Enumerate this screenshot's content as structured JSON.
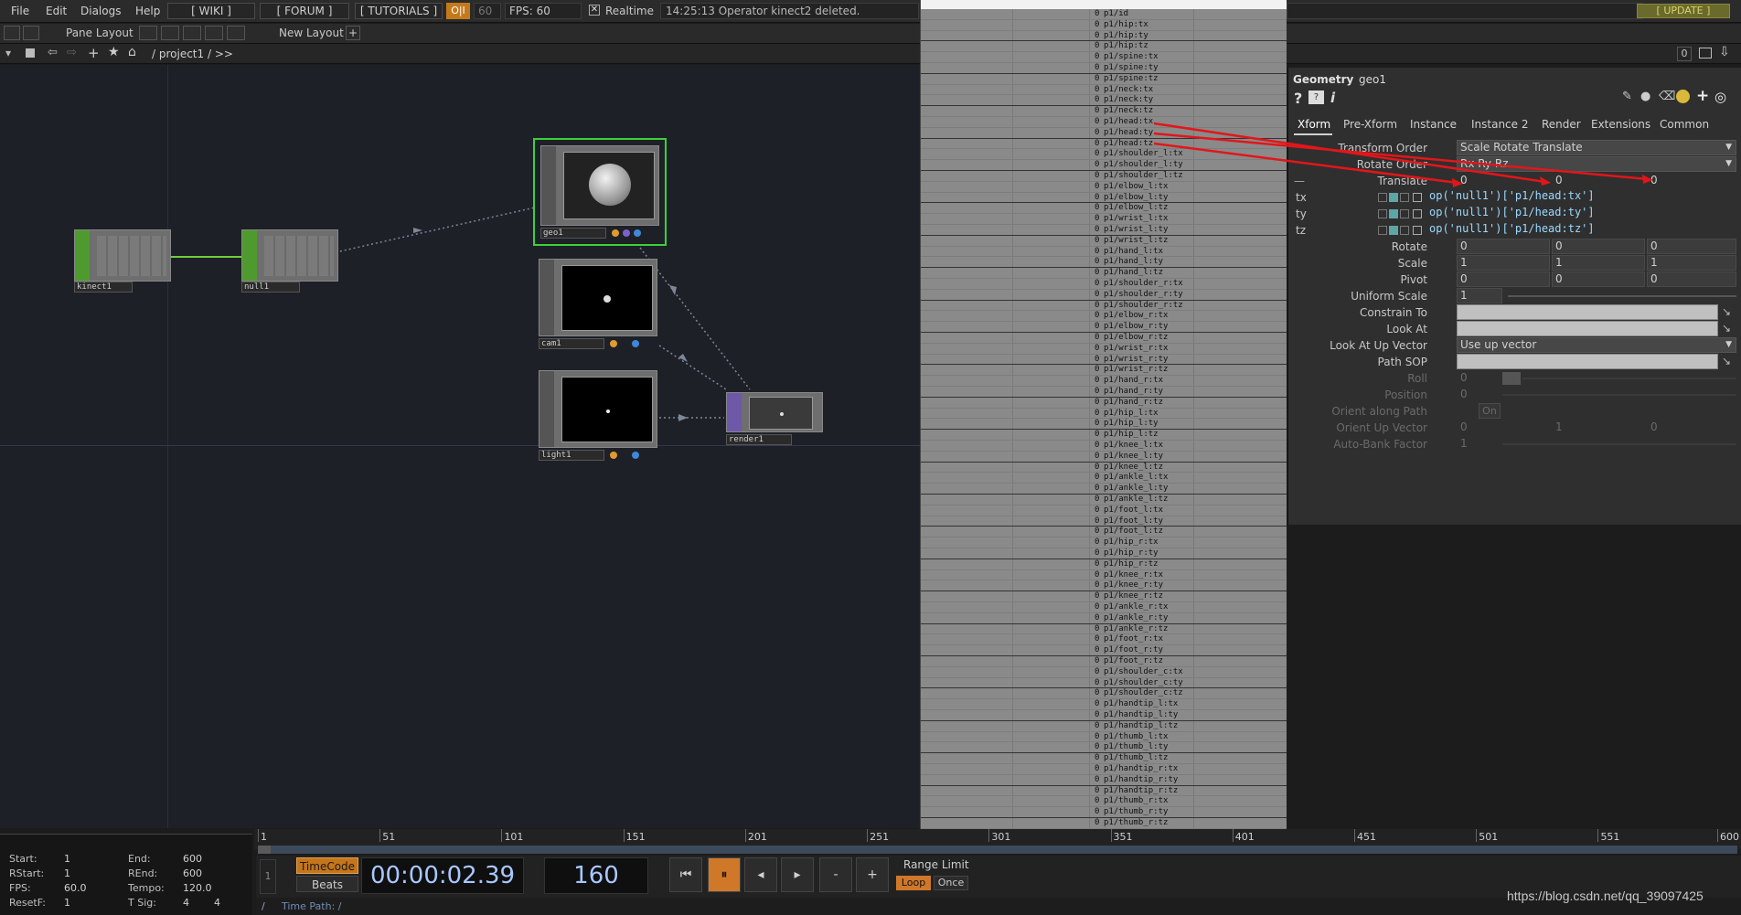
{
  "menubar": {
    "items": [
      "File",
      "Edit",
      "Dialogs",
      "Help"
    ],
    "wiki": "[ WIKI ]",
    "forum": "[ FORUM ]",
    "tutorials": "[ TUTORIALS ]",
    "oi": "O|I",
    "fps_box": "60",
    "fps_label": "FPS:  60",
    "realtime_label": "Realtime",
    "message": "14:25:13 Operator kinect2 deleted.",
    "update": "[ UPDATE ]"
  },
  "pane_row": {
    "pane_layout": "Pane Layout",
    "new_layout": "New Layout"
  },
  "path_row": {
    "path": "/ project1 / >>",
    "right_value": "0"
  },
  "nodes": {
    "kinect1": "kinect1",
    "null1": "null1",
    "geo1": "geo1",
    "cam1": "cam1",
    "light1": "light1",
    "render1": "render1"
  },
  "table": {
    "value": "0",
    "rows": [
      "p1/id",
      "p1/hip:tx",
      "p1/hip:ty",
      "p1/hip:tz",
      "p1/spine:tx",
      "p1/spine:ty",
      "p1/spine:tz",
      "p1/neck:tx",
      "p1/neck:ty",
      "p1/neck:tz",
      "p1/head:tx",
      "p1/head:ty",
      "p1/head:tz",
      "p1/shoulder_l:tx",
      "p1/shoulder_l:ty",
      "p1/shoulder_l:tz",
      "p1/elbow_l:tx",
      "p1/elbow_l:ty",
      "p1/elbow_l:tz",
      "p1/wrist_l:tx",
      "p1/wrist_l:ty",
      "p1/wrist_l:tz",
      "p1/hand_l:tx",
      "p1/hand_l:ty",
      "p1/hand_l:tz",
      "p1/shoulder_r:tx",
      "p1/shoulder_r:ty",
      "p1/shoulder_r:tz",
      "p1/elbow_r:tx",
      "p1/elbow_r:ty",
      "p1/elbow_r:tz",
      "p1/wrist_r:tx",
      "p1/wrist_r:ty",
      "p1/wrist_r:tz",
      "p1/hand_r:tx",
      "p1/hand_r:ty",
      "p1/hand_r:tz",
      "p1/hip_l:tx",
      "p1/hip_l:ty",
      "p1/hip_l:tz",
      "p1/knee_l:tx",
      "p1/knee_l:ty",
      "p1/knee_l:tz",
      "p1/ankle_l:tx",
      "p1/ankle_l:ty",
      "p1/ankle_l:tz",
      "p1/foot_l:tx",
      "p1/foot_l:ty",
      "p1/foot_l:tz",
      "p1/hip_r:tx",
      "p1/hip_r:ty",
      "p1/hip_r:tz",
      "p1/knee_r:tx",
      "p1/knee_r:ty",
      "p1/knee_r:tz",
      "p1/ankle_r:tx",
      "p1/ankle_r:ty",
      "p1/ankle_r:tz",
      "p1/foot_r:tx",
      "p1/foot_r:ty",
      "p1/foot_r:tz",
      "p1/shoulder_c:tx",
      "p1/shoulder_c:ty",
      "p1/shoulder_c:tz",
      "p1/handtip_l:tx",
      "p1/handtip_l:ty",
      "p1/handtip_l:tz",
      "p1/thumb_l:tx",
      "p1/thumb_l:ty",
      "p1/thumb_l:tz",
      "p1/handtip_r:tx",
      "p1/handtip_r:ty",
      "p1/handtip_r:tz",
      "p1/thumb_r:tx",
      "p1/thumb_r:ty",
      "p1/thumb_r:tz"
    ]
  },
  "params": {
    "type": "Geometry",
    "name": "geo1",
    "tabs": [
      "Xform",
      "Pre-Xform",
      "Instance",
      "Instance 2",
      "Render",
      "Extensions",
      "Common"
    ],
    "transform_order_label": "Transform Order",
    "transform_order_value": "Scale Rotate Translate",
    "rotate_order_label": "Rotate Order",
    "rotate_order_value": "Rx Ry Rz",
    "translate_label": "Translate",
    "translate": [
      "0",
      "0",
      "0"
    ],
    "tx_label": "tx",
    "ty_label": "ty",
    "tz_label": "tz",
    "tx_expr": "op('null1')['p1/head:tx']",
    "ty_expr": "op('null1')['p1/head:ty']",
    "tz_expr": "op('null1')['p1/head:tz']",
    "rotate_label": "Rotate",
    "rotate": [
      "0",
      "0",
      "0"
    ],
    "scale_label": "Scale",
    "scale": [
      "1",
      "1",
      "1"
    ],
    "pivot_label": "Pivot",
    "pivot": [
      "0",
      "0",
      "0"
    ],
    "uniform_scale_label": "Uniform Scale",
    "uniform_scale": "1",
    "constrain_to_label": "Constrain To",
    "look_at_label": "Look At",
    "look_at_up_label": "Look At Up Vector",
    "look_at_up_value": "Use up vector",
    "path_sop_label": "Path SOP",
    "roll_label": "Roll",
    "roll": "0",
    "position_label": "Position",
    "position": "0",
    "orient_path_label": "Orient along Path",
    "orient_path": "On",
    "orient_up_label": "Orient Up Vector",
    "orient_up": [
      "0",
      "1",
      "0"
    ],
    "auto_bank_label": "Auto-Bank Factor",
    "auto_bank": "1"
  },
  "timeline": {
    "ticks": [
      "1",
      "51",
      "101",
      "151",
      "201",
      "251",
      "301",
      "351",
      "401",
      "451",
      "501",
      "551",
      "600"
    ]
  },
  "stats": {
    "start_label": "Start:",
    "start": "1",
    "end_label": "End:",
    "end": "600",
    "rstart_label": "RStart:",
    "rstart": "1",
    "rend_label": "REnd:",
    "rend": "600",
    "fps_label": "FPS:",
    "fps": "60.0",
    "tempo_label": "Tempo:",
    "tempo": "120.0",
    "resetf_label": "ResetF:",
    "resetf": "1",
    "tsig_label": "T Sig:",
    "tsig_a": "4",
    "tsig_b": "4"
  },
  "transport": {
    "timecode": "TimeCode",
    "beats": "Beats",
    "time": "00:00:02.39",
    "frame": "160",
    "range_limit": "Range Limit",
    "loop": "Loop",
    "once": "Once",
    "minus": "-",
    "plus": "+"
  },
  "timepath": {
    "slash": "/",
    "label": "Time Path: /"
  },
  "watermark": "https://blog.csdn.net/qq_39097425"
}
